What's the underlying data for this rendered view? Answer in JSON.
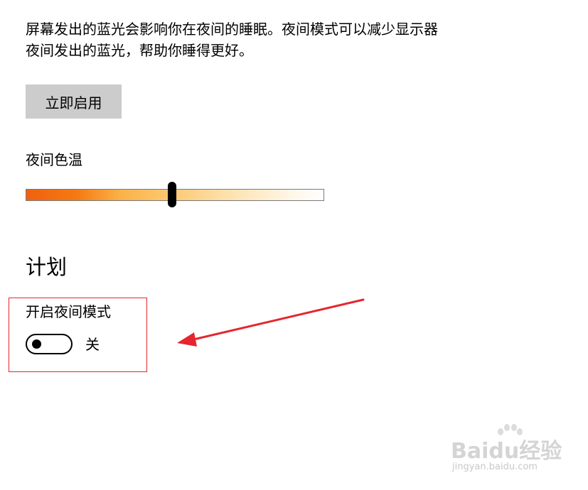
{
  "description": {
    "line1": "屏幕发出的蓝光会影响你在夜间的睡眠。夜间模式可以减少显示器",
    "line2": "夜间发出的蓝光，帮助你睡得更好。"
  },
  "enable_now_label": "立即启用",
  "color_temperature": {
    "label": "夜间色温",
    "level": 0.49
  },
  "schedule": {
    "title": "计划",
    "toggle_label": "开启夜间模式",
    "toggle_state": "关",
    "toggle_on": false
  },
  "annotation": {
    "color": "#e5262e"
  },
  "watermark": {
    "logo": "Baidu经验",
    "url": "jingyan.baidu.com"
  }
}
